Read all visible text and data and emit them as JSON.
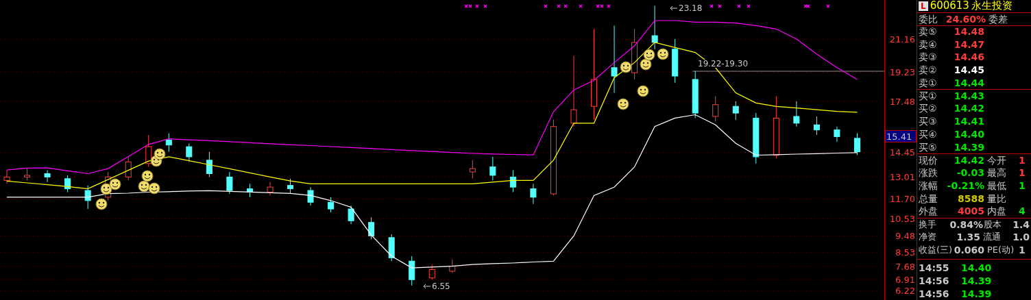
{
  "chart": {
    "annotations": [
      {
        "kind": "high",
        "text": "23.18"
      },
      {
        "kind": "range",
        "text": "19.22-19.30"
      },
      {
        "kind": "low",
        "text": "6.55"
      }
    ],
    "chart_data": {
      "type": "candlestick",
      "grid": true,
      "ylim": [
        5.69,
        23.52
      ],
      "yticks": [
        {
          "value": 21.16,
          "label": "21.16"
        },
        {
          "value": 19.23,
          "label": "19.23"
        },
        {
          "value": 17.48,
          "label": "17.48"
        },
        {
          "value": 14.45,
          "label": "14.45"
        },
        {
          "value": 13.01,
          "label": "13.01"
        },
        {
          "value": 11.7,
          "label": "11.70"
        },
        {
          "value": 10.53,
          "label": "10.53"
        },
        {
          "value": 9.48,
          "label": "9.48"
        },
        {
          "value": 8.53,
          "label": "8.53"
        },
        {
          "value": 7.68,
          "label": "7.68"
        },
        {
          "value": 6.91,
          "label": "6.91"
        },
        {
          "value": 6.22,
          "label": "6.22"
        }
      ],
      "ohlc": [
        [
          12.8,
          13.4,
          12.6,
          13.0
        ],
        [
          13.0,
          13.5,
          12.8,
          13.1
        ],
        [
          13.2,
          13.4,
          12.7,
          13.0
        ],
        [
          12.9,
          13.1,
          12.1,
          12.3
        ],
        [
          12.2,
          12.5,
          11.1,
          11.6
        ],
        [
          11.8,
          13.3,
          11.6,
          13.0
        ],
        [
          13.0,
          14.2,
          12.8,
          13.9
        ],
        [
          13.8,
          15.5,
          13.6,
          14.8
        ],
        [
          15.2,
          15.6,
          14.5,
          14.9
        ],
        [
          14.8,
          15.0,
          13.9,
          14.2
        ],
        [
          14.0,
          14.5,
          13.0,
          13.2
        ],
        [
          13.0,
          13.3,
          12.0,
          12.2
        ],
        [
          12.3,
          12.6,
          11.8,
          12.1
        ],
        [
          12.1,
          12.7,
          11.9,
          12.4
        ],
        [
          12.5,
          12.9,
          12.0,
          12.3
        ],
        [
          12.2,
          12.4,
          11.3,
          11.5
        ],
        [
          11.5,
          11.8,
          10.9,
          11.1
        ],
        [
          11.1,
          11.3,
          10.2,
          10.4
        ],
        [
          10.3,
          10.6,
          9.3,
          9.5
        ],
        [
          9.4,
          9.6,
          8.0,
          8.2
        ],
        [
          8.0,
          8.3,
          6.55,
          6.9
        ],
        [
          7.0,
          7.8,
          6.9,
          7.5
        ],
        [
          7.4,
          8.1,
          7.3,
          7.7
        ],
        [
          13.3,
          14.0,
          12.9,
          13.5
        ],
        [
          13.6,
          14.2,
          12.8,
          13.1
        ],
        [
          13.0,
          13.4,
          12.1,
          12.4
        ],
        [
          12.3,
          12.6,
          11.4,
          11.8
        ],
        [
          12.0,
          16.4,
          11.9,
          16.0
        ],
        [
          16.2,
          20.2,
          16.0,
          17.0
        ],
        [
          17.2,
          21.8,
          16.4,
          18.8
        ],
        [
          19.5,
          22.0,
          18.0,
          19.0
        ],
        [
          19.2,
          21.8,
          18.8,
          21.0
        ],
        [
          21.4,
          23.18,
          20.6,
          21.0
        ],
        [
          20.6,
          21.2,
          18.6,
          19.0
        ],
        [
          18.8,
          19.3,
          16.5,
          16.8
        ],
        [
          16.6,
          17.8,
          16.3,
          17.3
        ],
        [
          17.2,
          17.5,
          16.4,
          16.8
        ],
        [
          16.5,
          16.8,
          13.8,
          14.2
        ],
        [
          14.3,
          17.8,
          14.1,
          16.5
        ],
        [
          16.6,
          17.5,
          16.0,
          16.2
        ],
        [
          16.1,
          16.6,
          15.5,
          15.8
        ],
        [
          15.8,
          16.0,
          15.1,
          15.4
        ],
        [
          15.3,
          15.6,
          14.3,
          14.5
        ]
      ],
      "series": [
        {
          "type": "line",
          "color": "#ff00ff",
          "values": [
            13.42,
            13.53,
            13.54,
            13.37,
            13.2,
            13.5,
            14.22,
            14.94,
            15.27,
            15.21,
            15.16,
            15.1,
            15.04,
            14.98,
            14.92,
            14.87,
            14.81,
            14.75,
            14.69,
            14.63,
            14.57,
            14.52,
            14.46,
            14.4,
            14.37,
            14.34,
            14.31,
            16.88,
            18.17,
            18.75,
            19.8,
            20.8,
            22.3,
            22.3,
            22.2,
            22.2,
            22.15,
            22.0,
            21.8,
            21.2,
            20.3,
            19.5,
            18.8
          ]
        },
        {
          "type": "line",
          "color": "#ffff00",
          "values": [
            12.76,
            12.65,
            12.54,
            12.43,
            12.3,
            12.85,
            13.4,
            13.95,
            14.2,
            13.97,
            13.73,
            13.49,
            13.25,
            13.0,
            12.77,
            12.6,
            12.6,
            12.6,
            12.6,
            12.6,
            12.6,
            12.6,
            12.6,
            12.6,
            12.7,
            12.8,
            12.8,
            14.0,
            16.2,
            16.2,
            18.9,
            19.8,
            21.0,
            20.7,
            20.4,
            19.5,
            18.0,
            17.4,
            17.2,
            17.1,
            17.0,
            16.9,
            16.85
          ]
        },
        {
          "type": "line",
          "color": "#ffffff",
          "values": [
            11.8,
            11.8,
            11.8,
            11.8,
            11.8,
            12.01,
            12.04,
            12.1,
            12.13,
            12.17,
            12.19,
            12.15,
            12.11,
            12.07,
            12.03,
            11.9,
            11.6,
            11.2,
            9.55,
            8.3,
            7.6,
            7.65,
            7.7,
            7.8,
            7.85,
            7.89,
            7.95,
            8.0,
            9.5,
            11.9,
            12.4,
            13.6,
            16.0,
            16.5,
            16.7,
            16.1,
            15.0,
            14.3,
            14.33,
            14.36,
            14.39,
            14.42,
            14.45
          ]
        }
      ]
    }
  },
  "price_marker": {
    "label": "15.41"
  },
  "quote_panel": {
    "logo": "L",
    "code": "600613",
    "name": "永生投资",
    "ratio": {
      "label": "委比",
      "value": "24.60%",
      "label2": "委差"
    },
    "sell": [
      {
        "label": "卖⑤",
        "price": "14.48",
        "color": "#ff3c3c"
      },
      {
        "label": "卖④",
        "price": "14.47",
        "color": "#ff3c3c"
      },
      {
        "label": "卖③",
        "price": "14.46",
        "color": "#ff3c3c"
      },
      {
        "label": "卖②",
        "price": "14.45",
        "color": "#ffffff"
      },
      {
        "label": "卖①",
        "price": "14.44",
        "color": "#00e600"
      }
    ],
    "buy": [
      {
        "label": "买①",
        "price": "14.43",
        "color": "#00e600"
      },
      {
        "label": "买②",
        "price": "14.42",
        "color": "#00e600"
      },
      {
        "label": "买③",
        "price": "14.41",
        "color": "#00e600"
      },
      {
        "label": "买④",
        "price": "14.40",
        "color": "#00e600"
      },
      {
        "label": "买⑤",
        "price": "14.39",
        "color": "#00e600"
      }
    ],
    "stats": [
      {
        "left": {
          "label": "现价",
          "value": "14.42",
          "color": "#00e600"
        },
        "right": {
          "label": "今开",
          "value": "1",
          "color": "#ff3c3c"
        }
      },
      {
        "left": {
          "label": "涨跌",
          "value": "-0.03",
          "color": "#00e600"
        },
        "right": {
          "label": "最高",
          "value": "1",
          "color": "#ff3c3c"
        }
      },
      {
        "left": {
          "label": "涨幅",
          "value": "-0.21%",
          "color": "#00e600"
        },
        "right": {
          "label": "最低",
          "value": "1",
          "color": "#00e600"
        }
      },
      {
        "left": {
          "label": "总量",
          "value": "8588",
          "color": "#d2c800"
        },
        "right": {
          "label": "量比"
        }
      },
      {
        "left": {
          "label": "外盘",
          "value": "4005",
          "color": "#ff3c3c"
        },
        "right": {
          "label": "内盘",
          "value": "4",
          "color": "#00e600"
        }
      }
    ],
    "finance": [
      {
        "label": "换手",
        "value": "0.84%",
        "label2": "股本",
        "value2": "1.4"
      },
      {
        "label": "净资",
        "value": "1.35",
        "label2": "流通",
        "value2": "1.0"
      },
      {
        "label": "收益(三)",
        "value": "0.060",
        "label2": "PE(动)",
        "value2": "1"
      }
    ],
    "trades": [
      {
        "time": "14:55",
        "price": "14.40"
      },
      {
        "time": "14:56",
        "price": "14.39"
      },
      {
        "time": "14:56",
        "price": "14.39"
      }
    ]
  }
}
